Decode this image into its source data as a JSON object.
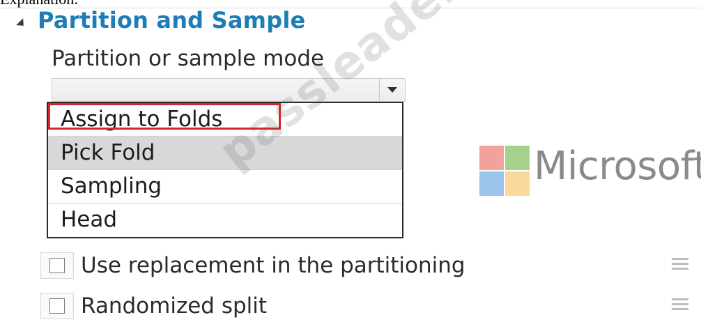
{
  "page_label": "Explanation:",
  "section": {
    "title": "Partition and Sample"
  },
  "mode_field": {
    "label": "Partition or sample mode",
    "value": "",
    "options": [
      "Assign to Folds",
      "Pick Fold",
      "Sampling",
      "Head"
    ],
    "highlighted_option": "Assign to Folds",
    "hovered_option": "Pick Fold"
  },
  "branding": {
    "logo_text": "Microsoft",
    "logo_colors": [
      "#f1a29a",
      "#a8d08d",
      "#9dc4ea",
      "#fad79a"
    ]
  },
  "watermark": "passleader.com",
  "options": {
    "use_replacement": {
      "label": "Use replacement in the partitioning",
      "checked": false
    },
    "randomized_split": {
      "label": "Randomized split",
      "checked": false
    }
  },
  "colors": {
    "title": "#1f7db6",
    "highlight": "#d8242a"
  }
}
